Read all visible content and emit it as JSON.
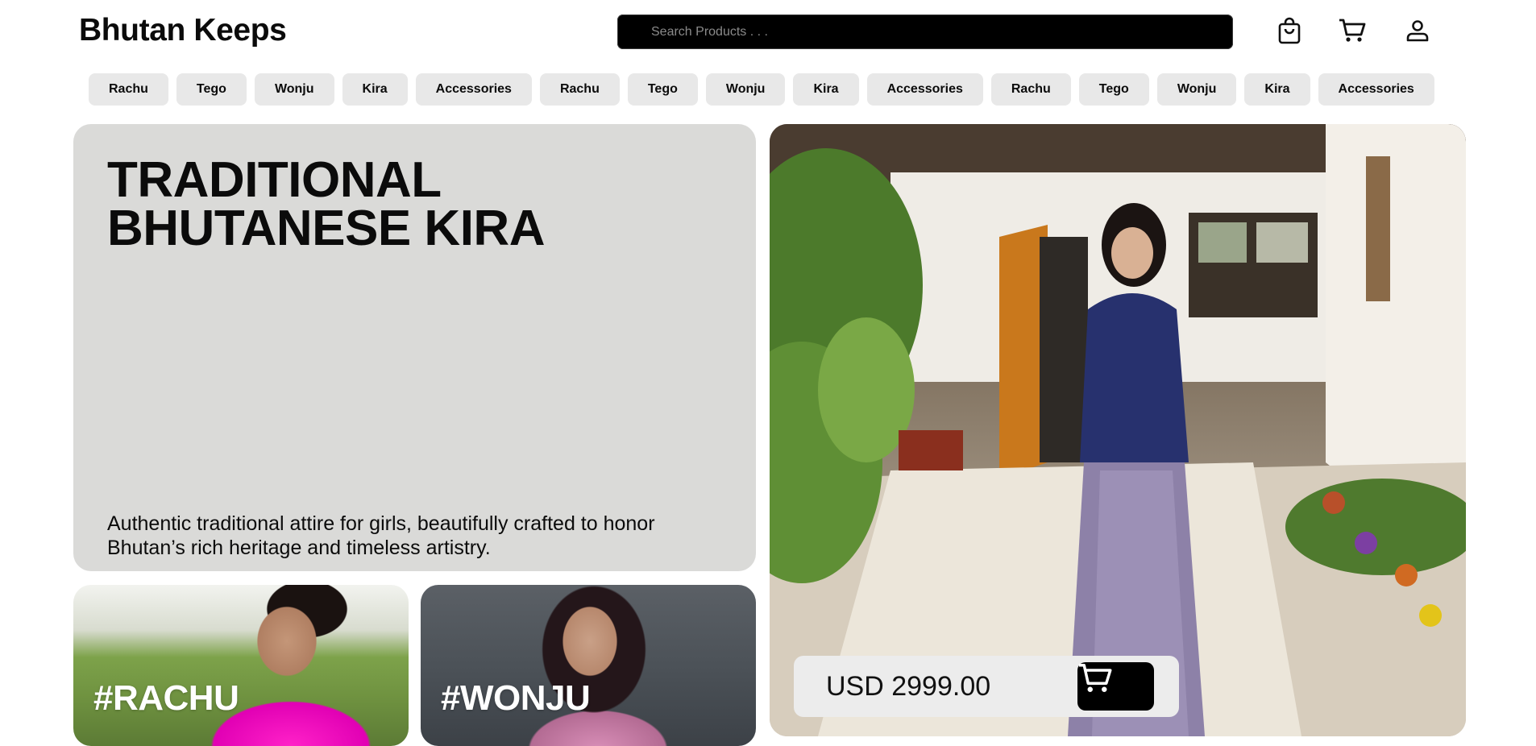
{
  "header": {
    "brand": "Bhutan Keeps",
    "search_placeholder": "Search Products . . ."
  },
  "header_icons": [
    "shopping-bag-icon",
    "cart-icon",
    "user-icon"
  ],
  "categories": [
    "Rachu",
    "Tego",
    "Wonju",
    "Kira",
    "Accessories",
    "Rachu",
    "Tego",
    "Wonju",
    "Kira",
    "Accessories",
    "Rachu",
    "Tego",
    "Wonju",
    "Kira",
    "Accessories"
  ],
  "hero": {
    "title_line1": "TRADITIONAL",
    "title_line2": "BHUTANESE KIRA",
    "description": "Authentic traditional attire for girls, beautifully crafted to honor Bhutan’s rich heritage and timeless artistry."
  },
  "tiles": {
    "rachu": "#RACHU",
    "wonju": "#WONJU"
  },
  "product": {
    "price": "USD 2999.00"
  },
  "colors": {
    "hero_bg": "#dadad8",
    "chip_bg": "#e8e8e8",
    "search_bg": "#000000",
    "price_bar_bg": "#ececec",
    "cart_button_bg": "#000000"
  }
}
